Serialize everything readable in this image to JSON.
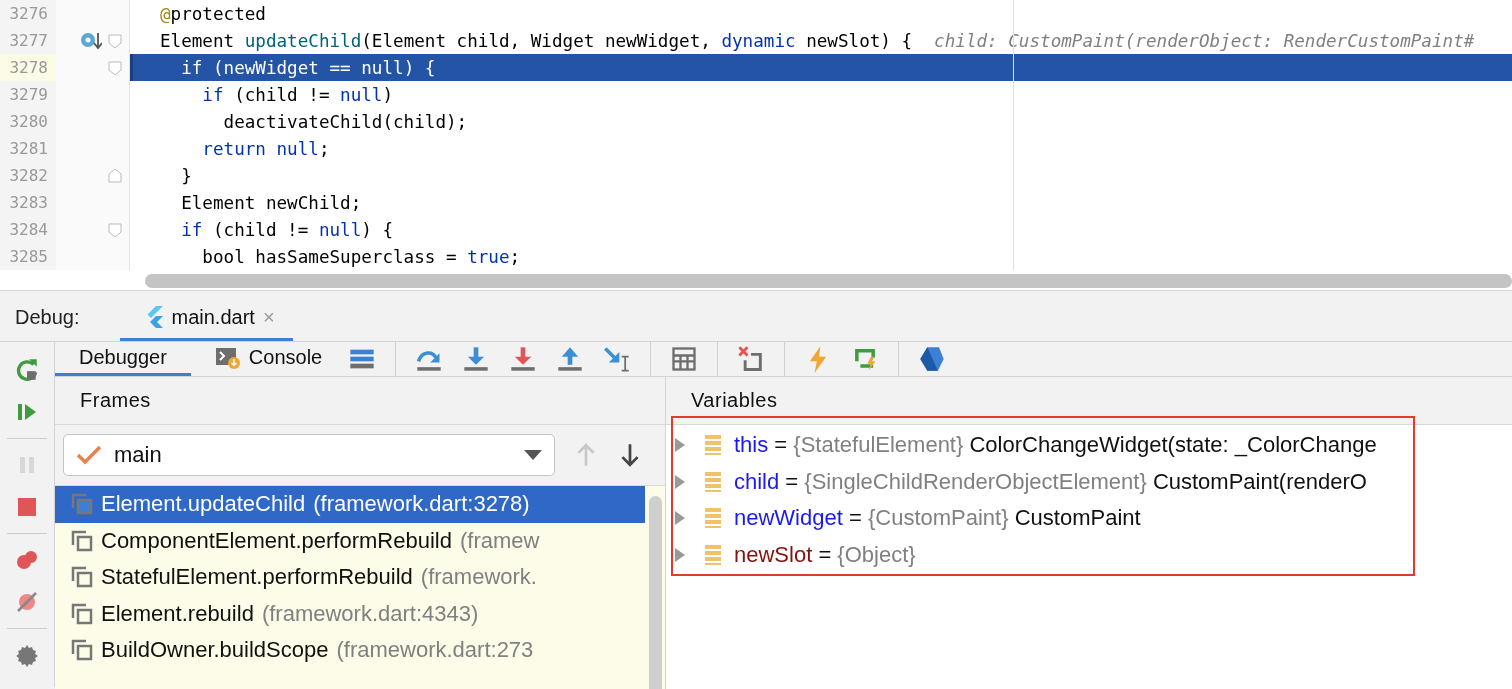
{
  "editor": {
    "lines": [
      {
        "number": "3276",
        "current": false,
        "gutter_mark": false,
        "fold_start": false,
        "fold_end": false,
        "tokens": [
          {
            "kind": "annotation",
            "text": "@"
          },
          {
            "kind": "plain",
            "text": "protected"
          }
        ]
      },
      {
        "number": "3277",
        "current": false,
        "gutter_mark": true,
        "fold_start": true,
        "fold_end": false,
        "tokens": [
          {
            "kind": "plain",
            "text": "Element "
          },
          {
            "kind": "fn",
            "text": "updateChild"
          },
          {
            "kind": "plain",
            "text": "(Element child, Widget newWidget, "
          },
          {
            "kind": "kw",
            "text": "dynamic"
          },
          {
            "kind": "plain",
            "text": " newSlot) {"
          }
        ],
        "hint": "child: CustomPaint(renderObject: RenderCustomPaint#"
      },
      {
        "number": "3278",
        "current": true,
        "gutter_mark": false,
        "fold_start": true,
        "fold_end": false,
        "tokens": [
          {
            "kind": "kw",
            "text": "  if"
          },
          {
            "kind": "plain",
            "text": " (newWidget == "
          },
          {
            "kind": "kw",
            "text": "null"
          },
          {
            "kind": "plain",
            "text": ") {"
          }
        ]
      },
      {
        "number": "3279",
        "current": false,
        "gutter_mark": false,
        "fold_start": false,
        "fold_end": false,
        "tokens": [
          {
            "kind": "kw",
            "text": "    if"
          },
          {
            "kind": "plain",
            "text": " (child != "
          },
          {
            "kind": "kw",
            "text": "null"
          },
          {
            "kind": "plain",
            "text": ")"
          }
        ]
      },
      {
        "number": "3280",
        "current": false,
        "gutter_mark": false,
        "fold_start": false,
        "fold_end": false,
        "tokens": [
          {
            "kind": "plain",
            "text": "      deactivateChild(child);"
          }
        ]
      },
      {
        "number": "3281",
        "current": false,
        "gutter_mark": false,
        "fold_start": false,
        "fold_end": false,
        "tokens": [
          {
            "kind": "kw",
            "text": "    return null"
          },
          {
            "kind": "plain",
            "text": ";"
          }
        ]
      },
      {
        "number": "3282",
        "current": false,
        "gutter_mark": false,
        "fold_start": false,
        "fold_end": true,
        "tokens": [
          {
            "kind": "plain",
            "text": "  }"
          }
        ]
      },
      {
        "number": "3283",
        "current": false,
        "gutter_mark": false,
        "fold_start": false,
        "fold_end": false,
        "tokens": [
          {
            "kind": "plain",
            "text": "  Element newChild;"
          }
        ]
      },
      {
        "number": "3284",
        "current": false,
        "gutter_mark": false,
        "fold_start": true,
        "fold_end": false,
        "tokens": [
          {
            "kind": "kw",
            "text": "  if"
          },
          {
            "kind": "plain",
            "text": " (child != "
          },
          {
            "kind": "kw",
            "text": "null"
          },
          {
            "kind": "plain",
            "text": ") {"
          }
        ]
      },
      {
        "number": "3285",
        "current": false,
        "gutter_mark": false,
        "fold_start": false,
        "fold_end": false,
        "tokens": [
          {
            "kind": "plain",
            "text": "    bool hasSameSuperclass = "
          },
          {
            "kind": "kw",
            "text": "true"
          },
          {
            "kind": "plain",
            "text": ";"
          }
        ]
      }
    ]
  },
  "debug_bar": {
    "label": "Debug:",
    "tabs": [
      {
        "label": "main.dart",
        "selected": true,
        "close": "×"
      }
    ]
  },
  "side_buttons": [
    {
      "kind": "resume",
      "disabled": false
    },
    {
      "kind": "pause",
      "disabled": true
    },
    {
      "kind": "stop",
      "disabled": false
    },
    {
      "kind": "breakpoints",
      "disabled": false
    },
    {
      "kind": "mute",
      "disabled": false
    },
    {
      "kind": "settings",
      "disabled": false
    }
  ],
  "toolbar": {
    "tabs": [
      {
        "kind": "debugger",
        "label": "Debugger",
        "selected": true
      },
      {
        "kind": "console",
        "label": "Console",
        "selected": false
      }
    ],
    "actions": [
      {
        "kind": "layout"
      },
      {
        "kind": "sep"
      },
      {
        "kind": "step-over"
      },
      {
        "kind": "step-into"
      },
      {
        "kind": "force-step-into"
      },
      {
        "kind": "step-out"
      },
      {
        "kind": "run-to-cursor"
      },
      {
        "kind": "sep"
      },
      {
        "kind": "evaluate"
      },
      {
        "kind": "sep"
      },
      {
        "kind": "drop-frame"
      },
      {
        "kind": "sep"
      },
      {
        "kind": "hot-reload"
      },
      {
        "kind": "hot-restart"
      },
      {
        "kind": "sep"
      },
      {
        "kind": "devtools"
      }
    ]
  },
  "frames": {
    "title": "Frames",
    "thread": "main",
    "nav": [
      {
        "kind": "up",
        "disabled": true
      },
      {
        "kind": "down",
        "disabled": false
      }
    ],
    "items": [
      {
        "name": "Element.updateChild",
        "location": "(framework.dart:3278)",
        "selected": true
      },
      {
        "name": "ComponentElement.performRebuild",
        "location": "(framew",
        "selected": false
      },
      {
        "name": "StatefulElement.performRebuild",
        "location": "(framework.",
        "selected": false
      },
      {
        "name": "Element.rebuild",
        "location": "(framework.dart:4343)",
        "selected": false
      },
      {
        "name": "BuildOwner.buildScope",
        "location": "(framework.dart:273",
        "selected": false
      }
    ]
  },
  "variables": {
    "title": "Variables",
    "outlined": true,
    "items": [
      {
        "name": "this",
        "color": "#1a1aee",
        "sign": "=",
        "type": "{StatefulElement}",
        "value": "ColorChangeWidget(state: _ColorChange"
      },
      {
        "name": "child",
        "color": "#1a1aee",
        "sign": "=",
        "type": "{SingleChildRenderObjectElement}",
        "value": "CustomPaint(renderO"
      },
      {
        "name": "newWidget",
        "color": "#1a1aee",
        "sign": "=",
        "type": "{CustomPaint}",
        "value": "CustomPaint"
      },
      {
        "name": "newSlot",
        "color": "#871010",
        "sign": "=",
        "type": "{Object}"
      }
    ]
  }
}
